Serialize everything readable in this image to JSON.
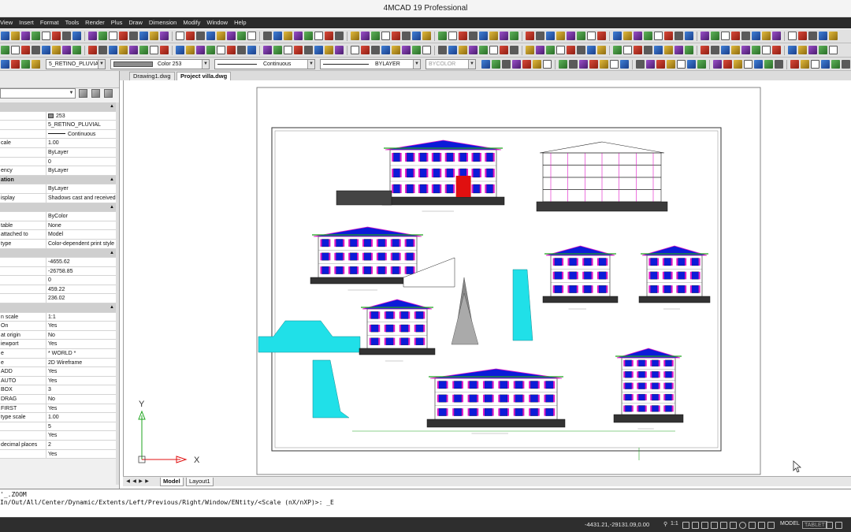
{
  "window": {
    "title": "4MCAD 19 Professional"
  },
  "menu": [
    "View",
    "Insert",
    "Format",
    "Tools",
    "Render",
    "Plus",
    "Draw",
    "Dimension",
    "Modify",
    "Window",
    "Help"
  ],
  "layer_bar": {
    "layer": "5_RETINO_PLUVIAL",
    "color": "Color 253",
    "linetype": "Continuous",
    "lineweight": "BYLAYER",
    "plotstyle": "BYCOLOR"
  },
  "properties": {
    "rows": [
      {
        "k": "",
        "v": "",
        "section": true
      },
      {
        "k": "",
        "v": "253",
        "color": true
      },
      {
        "k": "",
        "v": "5_RETINO_PLUVIAL"
      },
      {
        "k": "",
        "v": "Continuous",
        "linetype": true
      },
      {
        "k": "cale",
        "v": "1.00"
      },
      {
        "k": "",
        "v": "ByLayer"
      },
      {
        "k": "",
        "v": "0"
      },
      {
        "k": "ency",
        "v": "ByLayer"
      },
      {
        "k": "ation",
        "v": "",
        "section": true
      },
      {
        "k": "",
        "v": "ByLayer"
      },
      {
        "k": "isplay",
        "v": "Shadows cast and received"
      },
      {
        "k": "",
        "v": "",
        "section": true
      },
      {
        "k": "",
        "v": "ByColor"
      },
      {
        "k": "table",
        "v": "None"
      },
      {
        "k": "attached to",
        "v": "Model"
      },
      {
        "k": "type",
        "v": "Color-dependent print style"
      },
      {
        "k": "",
        "v": "",
        "section": true
      },
      {
        "k": "",
        "v": "-4655.62"
      },
      {
        "k": "",
        "v": "-26758.85"
      },
      {
        "k": "",
        "v": "0"
      },
      {
        "k": "",
        "v": "459.22"
      },
      {
        "k": "",
        "v": "236.02"
      },
      {
        "k": "",
        "v": "",
        "section": true
      },
      {
        "k": "n scale",
        "v": "1:1"
      },
      {
        "k": "On",
        "v": "Yes"
      },
      {
        "k": "at origin",
        "v": "No"
      },
      {
        "k": "iewport",
        "v": "Yes"
      },
      {
        "k": "e",
        "v": "* WORLD *"
      },
      {
        "k": "e",
        "v": "2D Wireframe"
      },
      {
        "k": "ADD",
        "v": "Yes"
      },
      {
        "k": "AUTO",
        "v": "Yes"
      },
      {
        "k": "BOX",
        "v": "3"
      },
      {
        "k": "DRAG",
        "v": "No"
      },
      {
        "k": "FIRST",
        "v": "Yes"
      },
      {
        "k": "type scale",
        "v": "1.00"
      },
      {
        "k": "",
        "v": "5"
      },
      {
        "k": "",
        "v": "Yes"
      },
      {
        "k": "decimal places",
        "v": "2"
      },
      {
        "k": "",
        "v": "Yes"
      }
    ]
  },
  "doc_tabs": [
    "Drawing1.dwg",
    "Project villa.dwg"
  ],
  "active_doc_tab": 1,
  "layout_tabs": [
    "Model",
    "Layout1"
  ],
  "axes": {
    "x": "X",
    "y": "Y"
  },
  "command": {
    "history": "'_.ZOOM",
    "prompt": "In/Out/All/Center/Dynamic/Extents/Left/Previous/Right/Window/ENtity/<Scale (nX/nXP)>: _E"
  },
  "status": {
    "coords": "-4431.21,-29131.09,0.00",
    "scale": "1:1",
    "model": "MODEL",
    "tablet": "TABLET"
  },
  "colors": {
    "menubar": "#2b2b2b",
    "blue": "#0c1bd8",
    "magenta": "#e018c8",
    "cyan": "#20e0e8",
    "red": "#e01010",
    "green": "#1fa51f"
  }
}
